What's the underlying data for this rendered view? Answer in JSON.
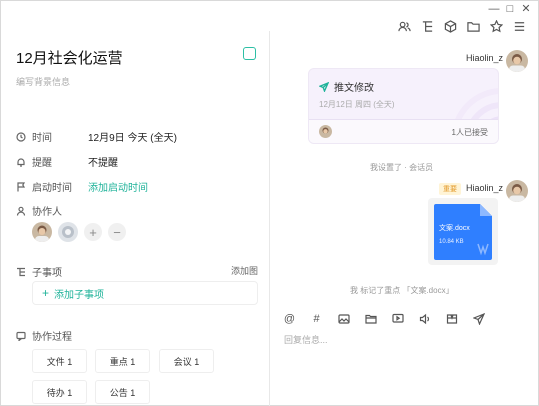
{
  "window": {
    "controls": [
      "—",
      "□",
      "✕"
    ],
    "toolbar_icons": [
      "people-icon",
      "subtask-icon",
      "cube-icon",
      "folder-icon",
      "star-icon",
      "menu-icon"
    ]
  },
  "task": {
    "title": "12月社会化运营",
    "desc_placeholder": "编写背景信息",
    "fields": [
      {
        "name": "time",
        "icon": "clock-icon",
        "label": "时间",
        "value": "12月9日 今天 (全天)",
        "link": false
      },
      {
        "name": "reminder",
        "icon": "bell-icon",
        "label": "提醒",
        "value": "不提醒",
        "link": false
      },
      {
        "name": "start-time",
        "icon": "flag-icon",
        "label": "启动时间",
        "value": "添加启动时间",
        "link": true
      }
    ],
    "collaborators_label": "协作人",
    "add_symbol": "+",
    "remove_symbol": "−",
    "subtasks_label": "子事项",
    "subtasks_right": "添加图",
    "add_subtask": "添加子事项",
    "process_label": "协作过程",
    "chips": [
      "文件 1",
      "重点 1",
      "会议 1",
      "待办 1",
      "公告 1"
    ]
  },
  "chat": {
    "user1": "Hiaolin_z",
    "card_title": "推文修改",
    "card_date": "12月12日 周四 (全天)",
    "card_accepted": "1人已接受",
    "sys_msg1": "我设置了 · 会话员",
    "tag": "重要",
    "user2": "Hiaolin_z",
    "file_name": "文案.docx",
    "file_size": "10.84 KB",
    "sys_msg2": "我 标记了重点 「文案.docx」",
    "reply_placeholder": "回复信息...",
    "tools": [
      "at-icon",
      "hash-icon",
      "image-icon",
      "folder-icon",
      "screen-icon",
      "voice-icon",
      "template-icon",
      "send-icon"
    ],
    "at_symbol": "@",
    "hash_symbol": "#"
  },
  "colors": {
    "accent": "#20b39a",
    "file_blue": "#2f7fff",
    "tag_bg": "#fff4d6",
    "card_bg": "#f6f1fc"
  }
}
